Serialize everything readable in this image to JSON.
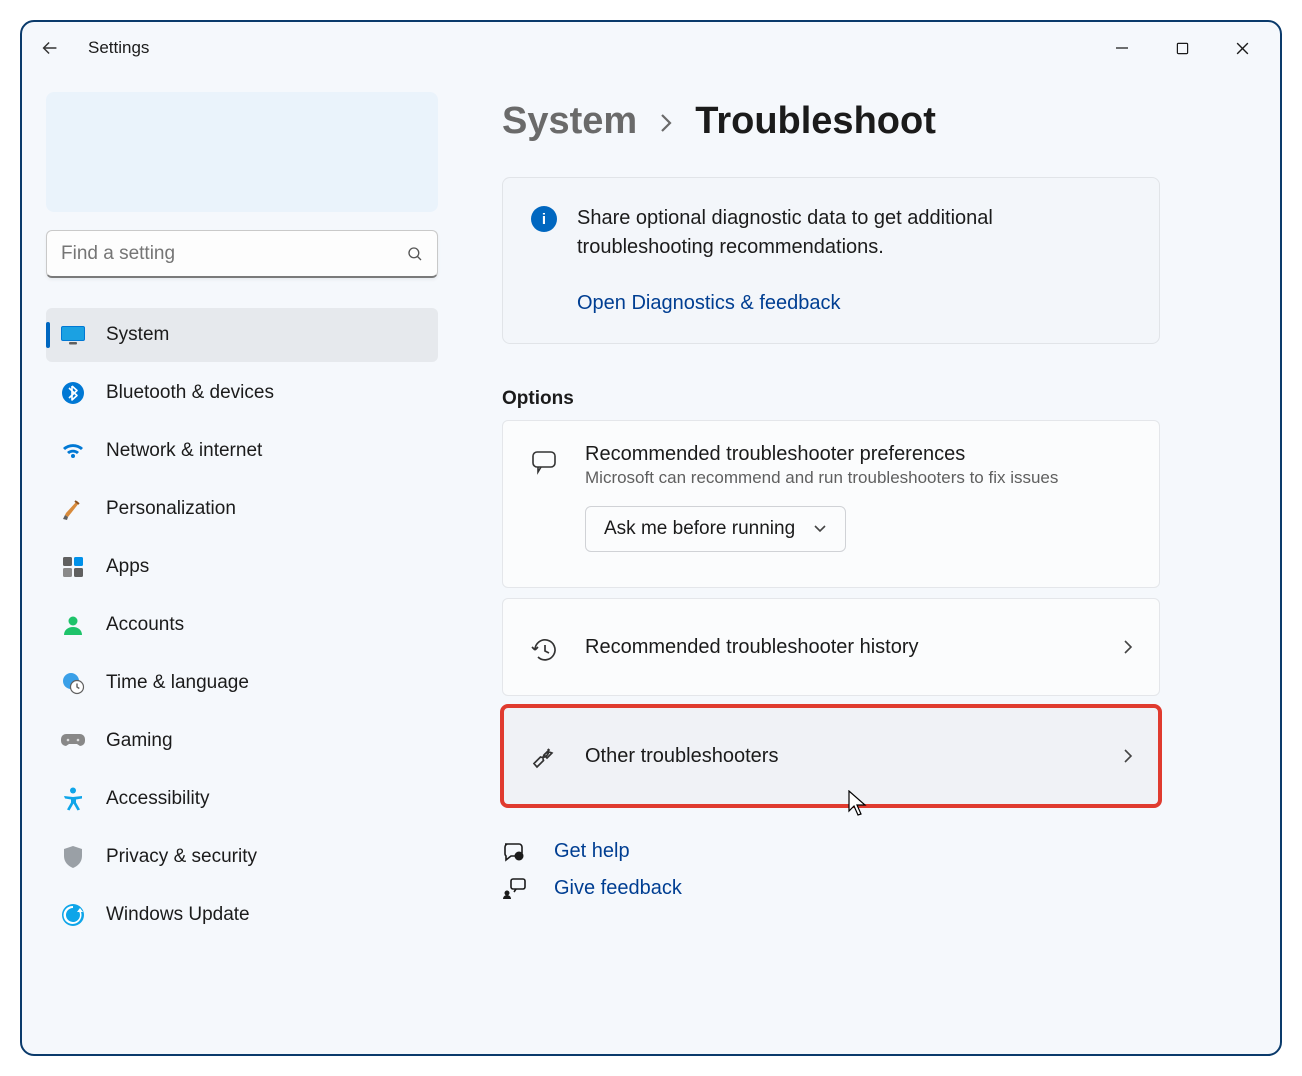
{
  "window": {
    "title": "Settings"
  },
  "search": {
    "placeholder": "Find a setting"
  },
  "sidebar": {
    "items": [
      {
        "label": "System",
        "icon": "monitor-icon",
        "active": true
      },
      {
        "label": "Bluetooth & devices",
        "icon": "bluetooth-icon"
      },
      {
        "label": "Network & internet",
        "icon": "wifi-icon"
      },
      {
        "label": "Personalization",
        "icon": "paintbrush-icon"
      },
      {
        "label": "Apps",
        "icon": "apps-icon"
      },
      {
        "label": "Accounts",
        "icon": "person-icon"
      },
      {
        "label": "Time & language",
        "icon": "globe-clock-icon"
      },
      {
        "label": "Gaming",
        "icon": "gamepad-icon"
      },
      {
        "label": "Accessibility",
        "icon": "accessibility-icon"
      },
      {
        "label": "Privacy & security",
        "icon": "shield-icon"
      },
      {
        "label": "Windows Update",
        "icon": "update-icon"
      }
    ]
  },
  "breadcrumb": {
    "parent": "System",
    "current": "Troubleshoot"
  },
  "banner": {
    "text": "Share optional diagnostic data to get additional troubleshooting recommendations.",
    "link": "Open Diagnostics & feedback"
  },
  "options": {
    "heading": "Options",
    "pref": {
      "title": "Recommended troubleshooter preferences",
      "sub": "Microsoft can recommend and run troubleshooters to fix issues",
      "dropdown": "Ask me before running"
    },
    "history": {
      "title": "Recommended troubleshooter history"
    },
    "other": {
      "title": "Other troubleshooters"
    }
  },
  "footer": {
    "help": "Get help",
    "feedback": "Give feedback"
  }
}
